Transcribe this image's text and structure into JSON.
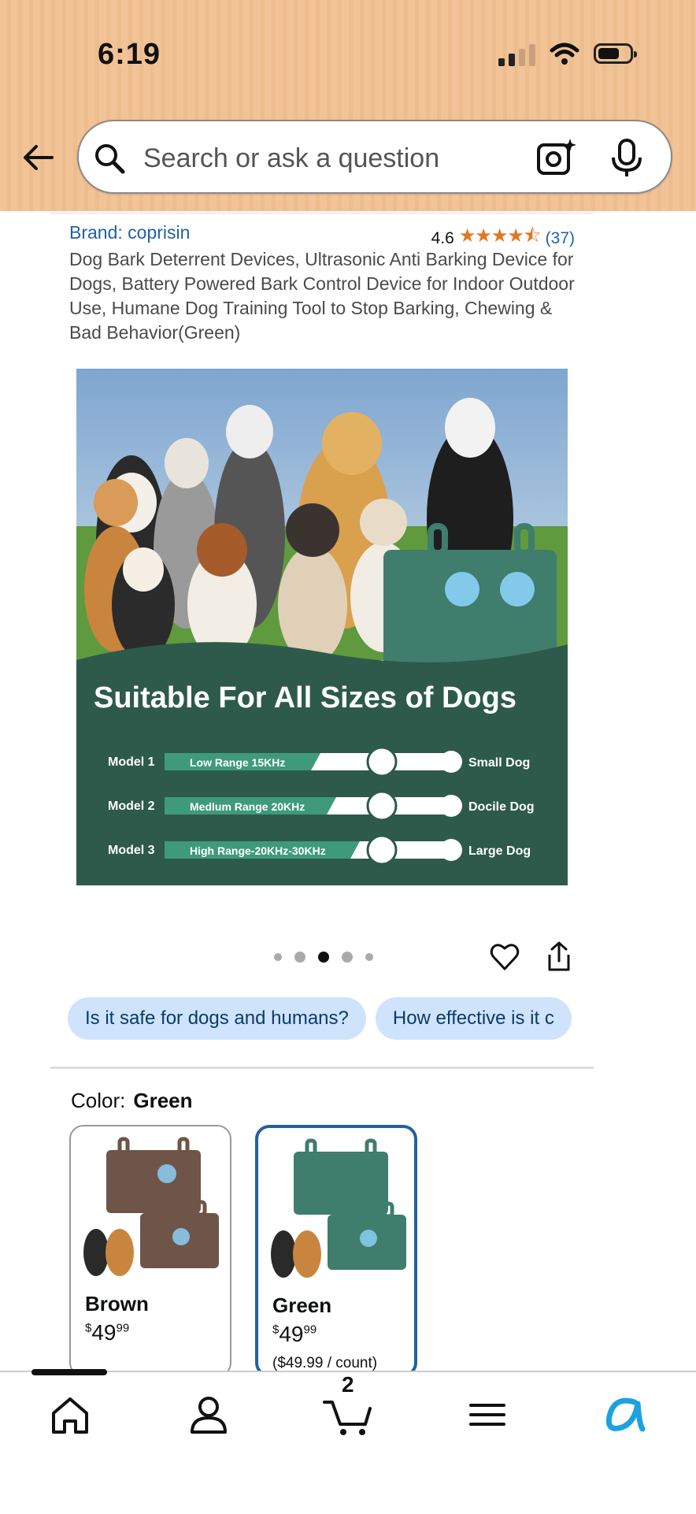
{
  "status_bar": {
    "time": "6:19"
  },
  "search": {
    "placeholder": "Search or ask a question"
  },
  "product": {
    "brand": "Brand: coprisin",
    "rating": "4.6",
    "stars": "★★★★⯪",
    "review_count": "(37)",
    "title": "Dog Bark Deterrent Devices, Ultrasonic Anti Barking Device for Dogs, Battery Powered Bark Control Device for Indoor Outdoor Use, Humane Dog Training Tool to Stop Barking, Chewing & Bad Behavior(Green)"
  },
  "image": {
    "headline": "Suitable For All Sizes of Dogs",
    "models": [
      {
        "model": "Model 1",
        "range": "Low Range  15KHz",
        "size": "Small Dog"
      },
      {
        "model": "Model 2",
        "range": "Medlum Range  20KHz",
        "size": "Docile Dog"
      },
      {
        "model": "Model 3",
        "range": "High Range-20KHz-30KHz",
        "size": "Large Dog"
      }
    ],
    "carousel": {
      "count": 5,
      "active": 3
    }
  },
  "chips": [
    "Is it safe for dogs and humans?",
    "How effective is it c"
  ],
  "color": {
    "label": "Color:",
    "selected": "Green",
    "options": [
      {
        "name": "Brown",
        "price_whole": "49",
        "price_frac": "99",
        "currency": "$",
        "unit": "",
        "device_color": "#6e5548"
      },
      {
        "name": "Green",
        "price_whole": "49",
        "price_frac": "99",
        "currency": "$",
        "unit": "($49.99 / count)",
        "device_color": "#3f7d6c"
      }
    ]
  },
  "bottom_nav": {
    "cart_count": "2",
    "items": [
      "home-icon",
      "account-icon",
      "cart-icon",
      "menu-icon",
      "rufus-icon"
    ]
  },
  "colors": {
    "header": "#f2c396",
    "link": "#2162a1",
    "star": "#de7921",
    "chip": "#cfe4fc",
    "panel": "#2d5a4b"
  }
}
